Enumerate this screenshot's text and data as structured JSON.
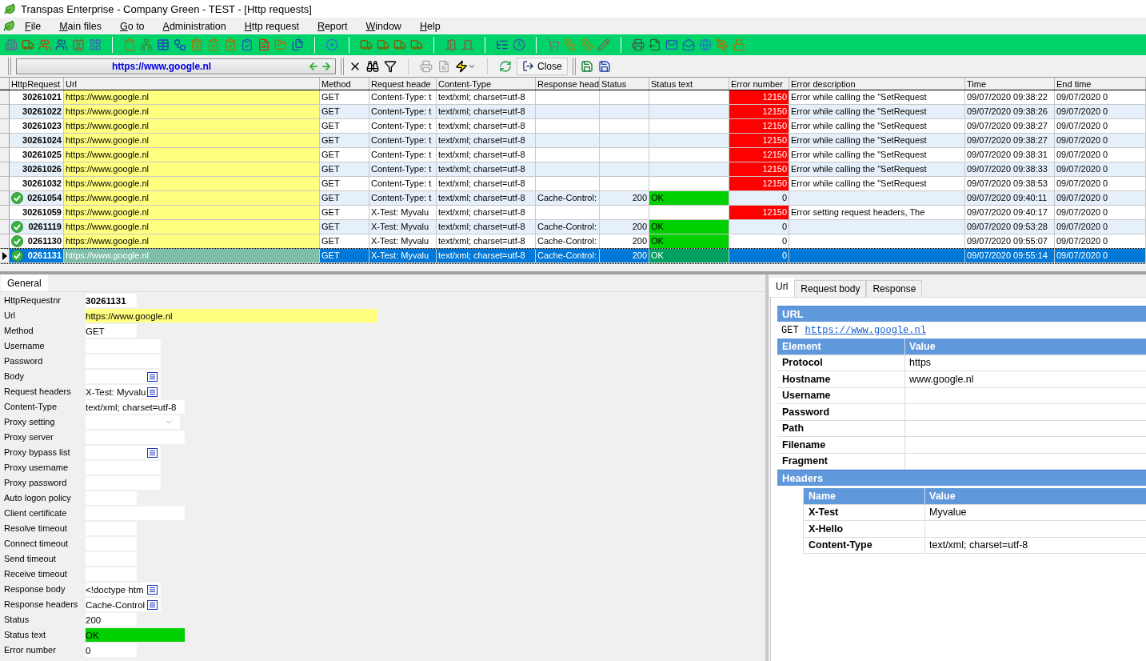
{
  "window": {
    "title": "Transpas Enterprise - Company Green - TEST - [Http requests]"
  },
  "menu": [
    "File",
    "Main files",
    "Go to",
    "Administration",
    "Http request",
    "Report",
    "Window",
    "Help"
  ],
  "address_bar": {
    "value": "https://www.google.nl"
  },
  "close_button": "Close",
  "grid": {
    "columns": [
      "HttpRequest",
      "Url",
      "Method",
      "Request heade",
      "Content-Type",
      "Response head",
      "Status",
      "Status text",
      "Error number",
      "Error description",
      "Time",
      "End time"
    ],
    "rows": [
      {
        "id": "30261021",
        "url": "https://www.google.nl",
        "method": "GET",
        "request_headers": "Content-Type: t",
        "content_type": "text/xml; charset=utf-8",
        "error_number": "12150",
        "error_description": "Error while calling the \"SetRequest",
        "time": "09/07/2020 09:38:22",
        "end_time": "09/07/2020 0",
        "success": false,
        "selected": false
      },
      {
        "id": "30261022",
        "url": "https://www.google.nl",
        "method": "GET",
        "request_headers": "Content-Type: t",
        "content_type": "text/xml; charset=utf-8",
        "error_number": "12150",
        "error_description": "Error while calling the \"SetRequest",
        "time": "09/07/2020 09:38:26",
        "end_time": "09/07/2020 0",
        "success": false,
        "selected": false
      },
      {
        "id": "30261023",
        "url": "https://www.google.nl",
        "method": "GET",
        "request_headers": "Content-Type: t",
        "content_type": "text/xml; charset=utf-8",
        "error_number": "12150",
        "error_description": "Error while calling the \"SetRequest",
        "time": "09/07/2020 09:38:27",
        "end_time": "09/07/2020 0",
        "success": false,
        "selected": false
      },
      {
        "id": "30261024",
        "url": "https://www.google.nl",
        "method": "GET",
        "request_headers": "Content-Type: t",
        "content_type": "text/xml; charset=utf-8",
        "error_number": "12150",
        "error_description": "Error while calling the \"SetRequest",
        "time": "09/07/2020 09:38:27",
        "end_time": "09/07/2020 0",
        "success": false,
        "selected": false
      },
      {
        "id": "30261025",
        "url": "https://www.google.nl",
        "method": "GET",
        "request_headers": "Content-Type: t",
        "content_type": "text/xml; charset=utf-8",
        "error_number": "12150",
        "error_description": "Error while calling the \"SetRequest",
        "time": "09/07/2020 09:38:31",
        "end_time": "09/07/2020 0",
        "success": false,
        "selected": false
      },
      {
        "id": "30261026",
        "url": "https://www.google.nl",
        "method": "GET",
        "request_headers": "Content-Type: t",
        "content_type": "text/xml; charset=utf-8",
        "error_number": "12150",
        "error_description": "Error while calling the \"SetRequest",
        "time": "09/07/2020 09:38:33",
        "end_time": "09/07/2020 0",
        "success": false,
        "selected": false
      },
      {
        "id": "30261032",
        "url": "https://www.google.nl",
        "method": "GET",
        "request_headers": "Content-Type: t",
        "content_type": "text/xml; charset=utf-8",
        "error_number": "12150",
        "error_description": "Error while calling the \"SetRequest",
        "time": "09/07/2020 09:38:53",
        "end_time": "09/07/2020 0",
        "success": false,
        "selected": false
      },
      {
        "id": "0261054",
        "url": "https://www.google.nl",
        "method": "GET",
        "request_headers": "Content-Type: t",
        "content_type": "text/xml; charset=utf-8",
        "response_headers": "Cache-Control:",
        "status": "200",
        "status_text": "OK",
        "error_number": "0",
        "time": "09/07/2020 09:40:11",
        "end_time": "09/07/2020 0",
        "success": true,
        "selected": false
      },
      {
        "id": "30261059",
        "url": "https://www.google.nl",
        "method": "GET",
        "request_headers": "X-Test: Myvalu",
        "content_type": "text/xml; charset=utf-8",
        "error_number": "12150",
        "error_description": "Error setting request headers, The",
        "time": "09/07/2020 09:40:17",
        "end_time": "09/07/2020 0",
        "success": false,
        "selected": false
      },
      {
        "id": "0261119",
        "url": "https://www.google.nl",
        "method": "GET",
        "request_headers": "X-Test: Myvalu",
        "content_type": "text/xml; charset=utf-8",
        "response_headers": "Cache-Control:",
        "status": "200",
        "status_text": "OK",
        "error_number": "0",
        "time": "09/07/2020 09:53:28",
        "end_time": "09/07/2020 0",
        "success": true,
        "selected": false
      },
      {
        "id": "0261130",
        "url": "https://www.google.nl",
        "method": "GET",
        "request_headers": "X-Test: Myvalu",
        "content_type": "text/xml; charset=utf-8",
        "response_headers": "Cache-Control:",
        "status": "200",
        "status_text": "OK",
        "error_number": "0",
        "time": "09/07/2020 09:55:07",
        "end_time": "09/07/2020 0",
        "success": true,
        "selected": false
      },
      {
        "id": "0261131",
        "url": "https://www.google.nl",
        "method": "GET",
        "request_headers": "X-Test: Myvalu",
        "content_type": "text/xml; charset=utf-8",
        "response_headers": "Cache-Control:",
        "status": "200",
        "status_text": "OK",
        "error_number": "0",
        "time": "09/07/2020 09:55:14",
        "end_time": "09/07/2020 0",
        "success": true,
        "selected": true
      }
    ]
  },
  "detail_tabs": [
    {
      "label": "General",
      "selected": true
    }
  ],
  "form": [
    {
      "label": "HttpRequestnr",
      "value": "30261131",
      "kind": "key"
    },
    {
      "label": "Url",
      "value": "https://www.google.nl",
      "kind": "text",
      "color": "#ffff80"
    },
    {
      "label": "Method",
      "value": "GET",
      "kind": "text"
    },
    {
      "label": "Username",
      "kind": "text"
    },
    {
      "label": "Password",
      "kind": "text"
    },
    {
      "label": "Body",
      "kind": "memo"
    },
    {
      "label": "Request headers",
      "value": "X-Test: Myvalu",
      "kind": "memo"
    },
    {
      "label": "Content-Type",
      "value": "text/xml; charset=utf-8",
      "kind": "text"
    },
    {
      "label": "Proxy setting",
      "kind": "dropdown"
    },
    {
      "label": "Proxy server",
      "kind": "text"
    },
    {
      "label": "Proxy bypass list",
      "kind": "memo"
    },
    {
      "label": "Proxy username",
      "kind": "text"
    },
    {
      "label": "Proxy password",
      "kind": "text"
    },
    {
      "label": "Auto logon policy",
      "kind": "text"
    },
    {
      "label": "Client certificate",
      "kind": "text"
    },
    {
      "label": "Resolve timeout",
      "kind": "text"
    },
    {
      "label": "Connect timeout",
      "kind": "text"
    },
    {
      "label": "Send timeout",
      "kind": "text"
    },
    {
      "label": "Receive timeout",
      "kind": "text"
    },
    {
      "label": "Response body",
      "value": "<!doctype htm",
      "kind": "memo"
    },
    {
      "label": "Response headers",
      "value": "Cache-Control",
      "kind": "memo"
    },
    {
      "label": "Status",
      "value": "200",
      "kind": "text"
    },
    {
      "label": "Status text",
      "value": "OK",
      "kind": "text",
      "color": "#00d000"
    },
    {
      "label": "Error number",
      "value": "0",
      "kind": "text"
    }
  ],
  "url_tabs": [
    {
      "label": "Url",
      "selected": true
    },
    {
      "label": "Request body",
      "selected": false
    },
    {
      "label": "Response",
      "selected": false
    }
  ],
  "url_view": {
    "title": "URL",
    "method": "GET",
    "link": "https://www.google.nl",
    "element_header": [
      "Element",
      "Value"
    ],
    "elements": [
      {
        "name": "Protocol",
        "value": "https"
      },
      {
        "name": "Hostname",
        "value": "www.google.nl"
      },
      {
        "name": "Username"
      },
      {
        "name": "Password"
      },
      {
        "name": "Path"
      },
      {
        "name": "Filename"
      },
      {
        "name": "Fragment"
      }
    ],
    "headers_title": "Headers",
    "headers_header": [
      "Name",
      "Value"
    ],
    "headers": [
      {
        "name": "X-Test",
        "value": "Myvalue"
      },
      {
        "name": "X-Hello"
      },
      {
        "name": "Content-Type",
        "value": "text/xml; charset=utf-8"
      }
    ]
  }
}
